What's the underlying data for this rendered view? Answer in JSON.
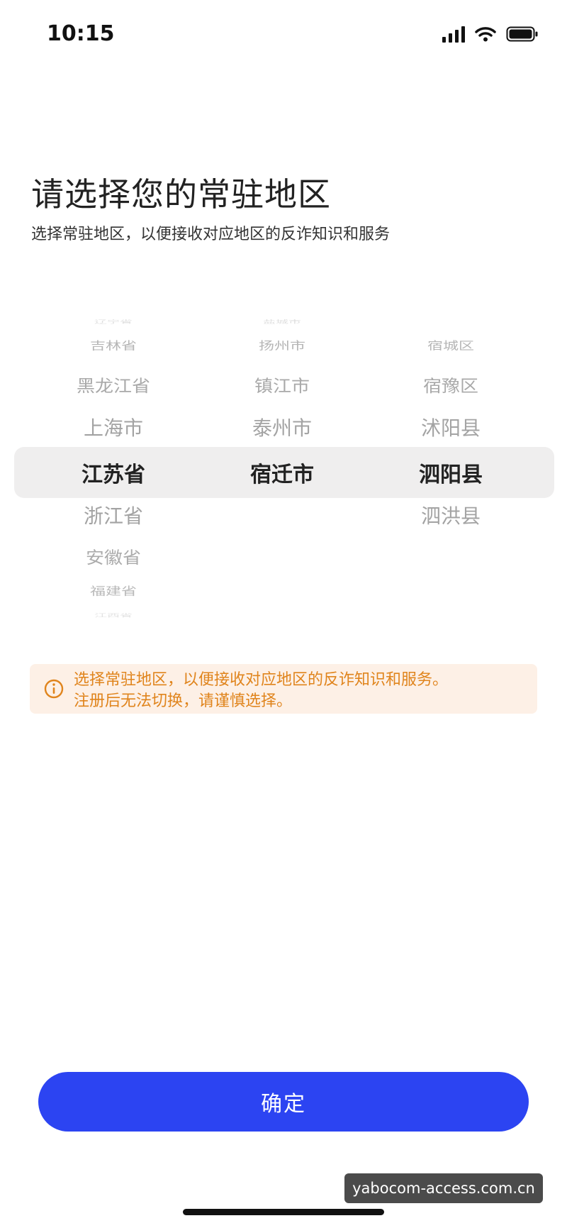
{
  "status_bar": {
    "time": "10:15",
    "icons": [
      "signal-icon",
      "wifi-icon",
      "battery-icon"
    ]
  },
  "header": {
    "title": "请选择您的常驻地区",
    "subtitle": "选择常驻地区，以便接收对应地区的反诈知识和服务"
  },
  "picker": {
    "provinces": {
      "before": [
        "辽宁省",
        "吉林省",
        "黑龙江省",
        "上海市"
      ],
      "selected": "江苏省",
      "after": [
        "浙江省",
        "安徽省",
        "福建省",
        "江西省"
      ]
    },
    "cities": {
      "before": [
        "盐城市",
        "扬州市",
        "镇江市",
        "泰州市"
      ],
      "selected": "宿迁市",
      "after": []
    },
    "districts": {
      "before": [
        "宿城区",
        "宿豫区",
        "沭阳县"
      ],
      "selected": "泗阳县",
      "after": [
        "泗洪县"
      ]
    }
  },
  "notice": {
    "icon": "info-icon",
    "line1": "选择常驻地区，以便接收对应地区的反诈知识和服务。",
    "line2": "注册后无法切换，请谨慎选择。",
    "color": "#e0841c",
    "background": "#fdf0e6"
  },
  "confirm_button": {
    "label": "确定",
    "color": "#2c44f2"
  },
  "watermark": "yabocom-access.com.cn"
}
